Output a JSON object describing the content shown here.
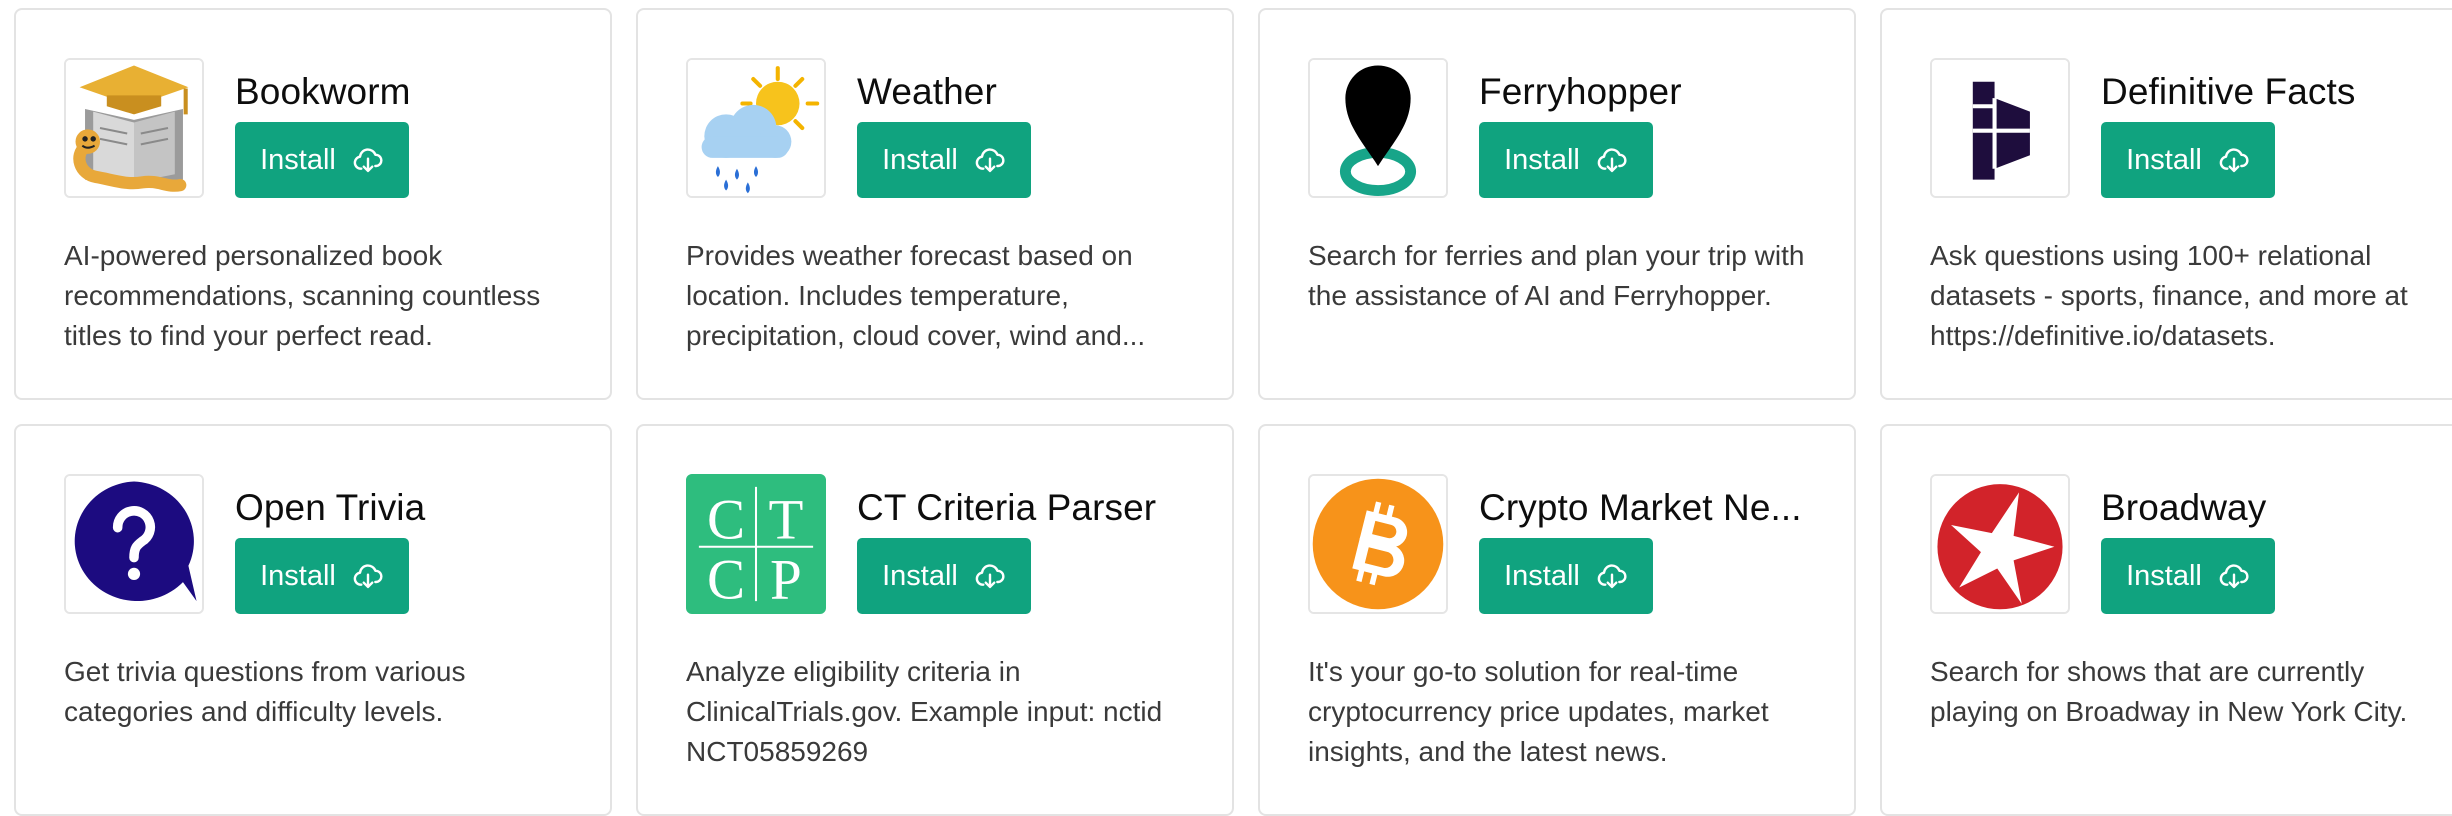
{
  "install_label": "Install",
  "colors": {
    "install_bg": "#10a37f",
    "card_border": "#e3e3e3",
    "text_primary": "#0d0d0d",
    "text_secondary": "#3a3a3a"
  },
  "plugins": [
    {
      "name": "Bookworm",
      "icon": "bookworm-logo",
      "description": "AI-powered personalized book recommendations, scanning countless titles to find your perfect read."
    },
    {
      "name": "Weather",
      "icon": "weather-logo",
      "description": "Provides weather forecast based on location. Includes temperature, precipitation, cloud cover, wind and..."
    },
    {
      "name": "Ferryhopper",
      "icon": "ferryhopper-logo",
      "description": "Search for ferries and plan your trip with the assistance of AI and Ferryhopper."
    },
    {
      "name": "Definitive Facts",
      "icon": "definitive-facts-logo",
      "description": "Ask questions using 100+ relational datasets - sports, finance, and more at https://definitive.io/datasets."
    },
    {
      "name": "Open Trivia",
      "icon": "open-trivia-logo",
      "description": "Get trivia questions from various categories and difficulty levels."
    },
    {
      "name": "CT Criteria Parser",
      "icon": "ct-criteria-parser-logo",
      "logo_letters": [
        "C",
        "T",
        "C",
        "P"
      ],
      "description": "Analyze eligibility criteria in ClinicalTrials.gov. Example input: nctid NCT05859269"
    },
    {
      "name": "Crypto Market Ne...",
      "icon": "crypto-market-news-logo",
      "description": "It's your go-to solution for real-time cryptocurrency price updates, market insights, and the latest news."
    },
    {
      "name": "Broadway",
      "icon": "broadway-logo",
      "description": "Search for shows that are currently playing on Broadway in New York City."
    }
  ]
}
